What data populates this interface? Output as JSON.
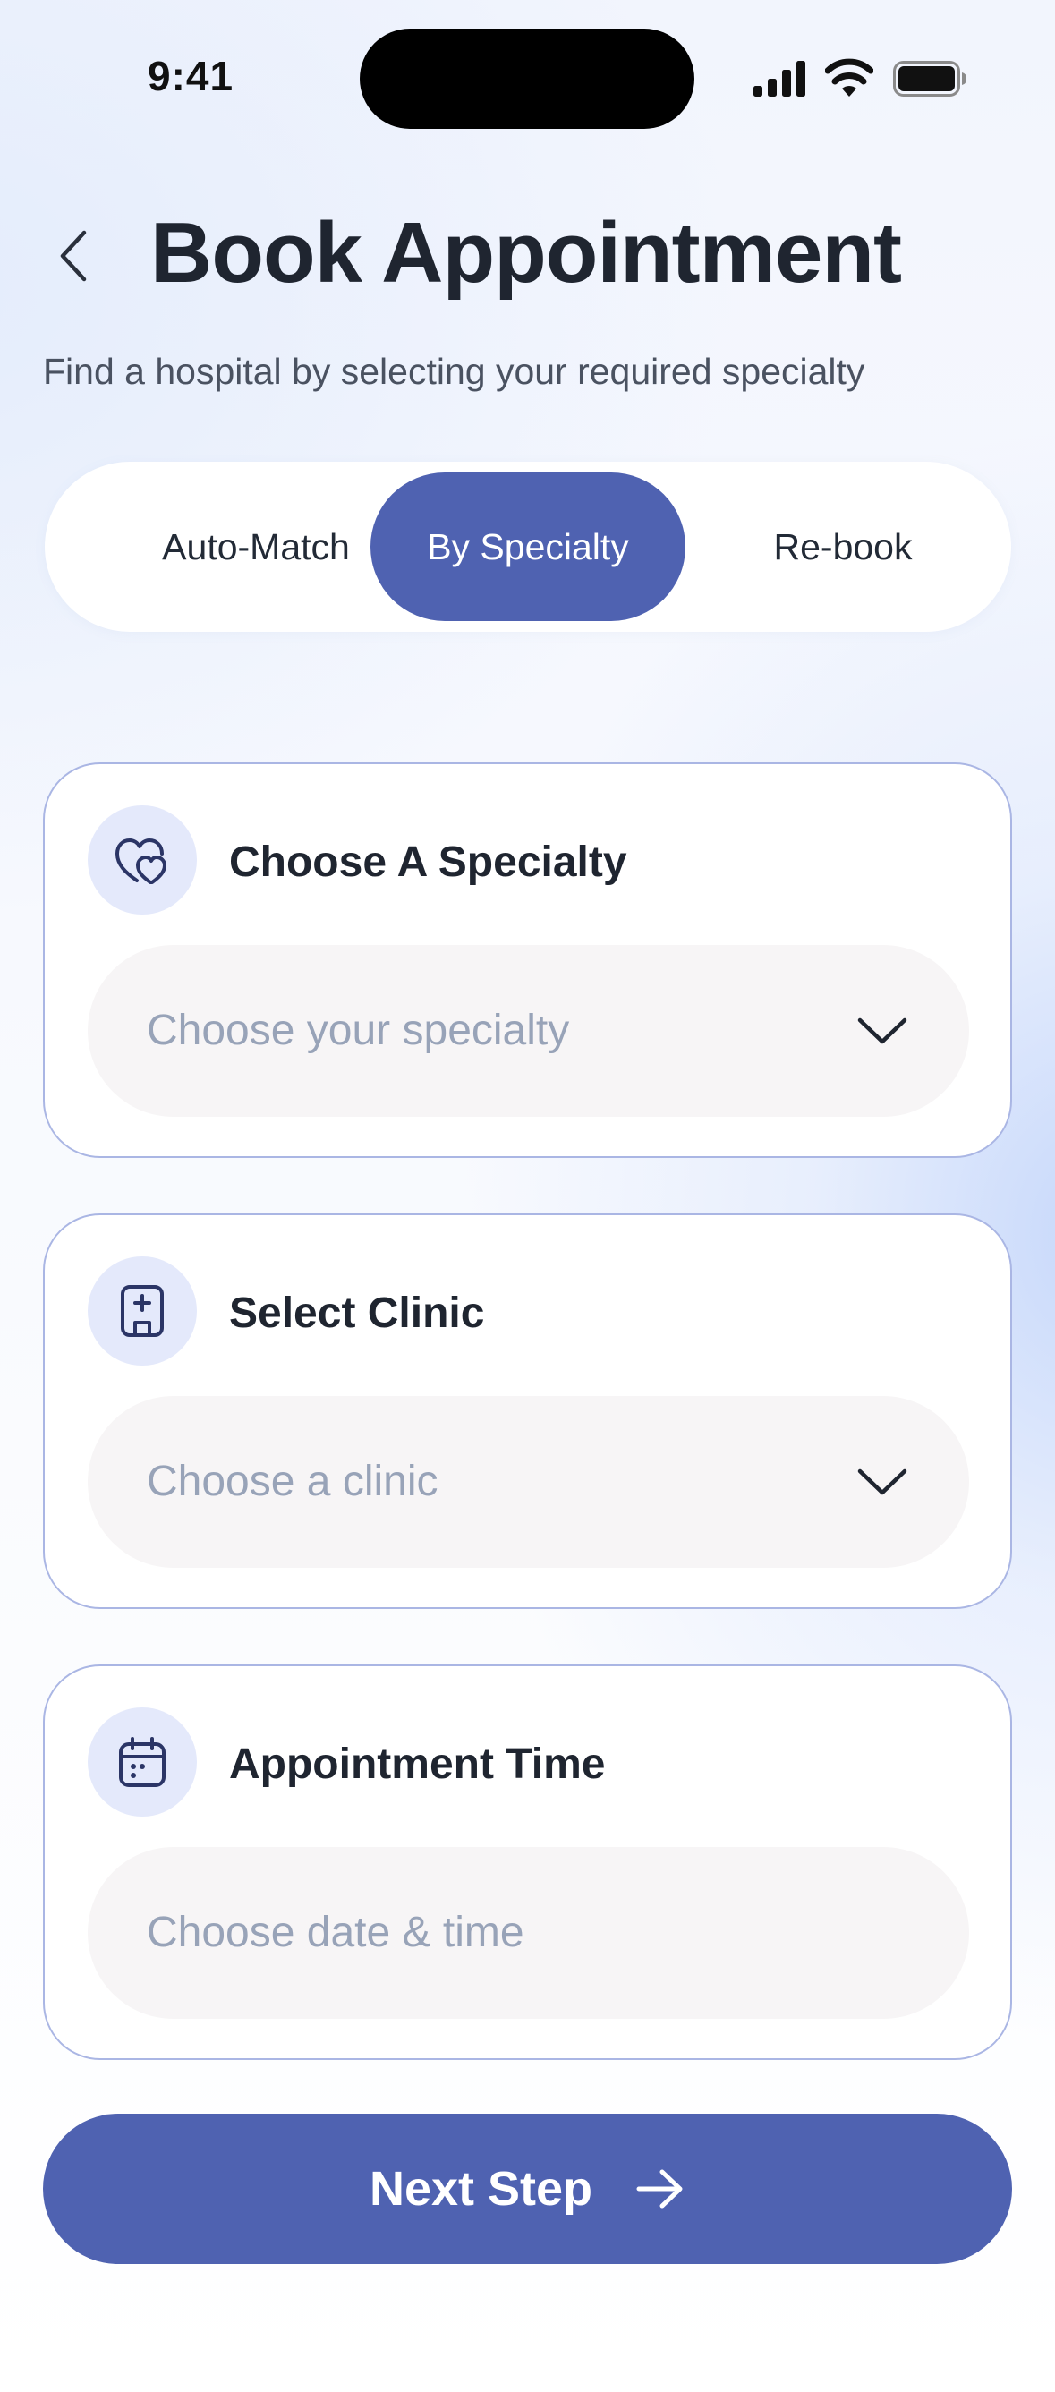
{
  "status_bar": {
    "time": "9:41"
  },
  "header": {
    "title": "Book Appointment",
    "subtitle": "Find a hospital by selecting your required specialty"
  },
  "segments": [
    {
      "label": "Auto-Match",
      "active": false
    },
    {
      "label": "By Specialty",
      "active": true
    },
    {
      "label": "Re-book",
      "active": false
    }
  ],
  "cards": {
    "specialty": {
      "title": "Choose A Specialty",
      "placeholder": "Choose your specialty",
      "icon": "hearts-icon"
    },
    "clinic": {
      "title": "Select Clinic",
      "placeholder": "Choose a clinic",
      "icon": "hospital-icon"
    },
    "time": {
      "title": "Appointment Time",
      "placeholder": "Choose date & time",
      "icon": "calendar-icon"
    }
  },
  "next_button": {
    "label": "Next Step"
  },
  "colors": {
    "accent": "#4f62b1",
    "icon_bg": "#e4e9fb",
    "card_border": "#aab6e4",
    "field_bg": "#f7f5f6",
    "placeholder": "#98a3b8"
  }
}
